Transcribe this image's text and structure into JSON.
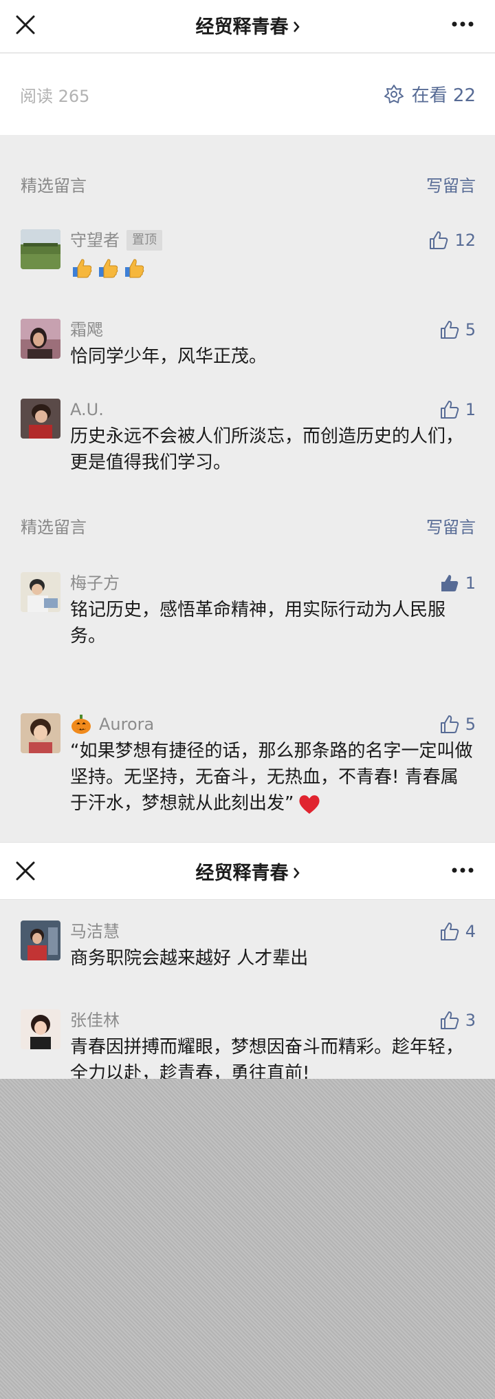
{
  "navbar": {
    "title": "经贸释青春"
  },
  "readbar": {
    "reads": "阅读 265",
    "watching": "在看 22"
  },
  "sections": [
    {
      "label": "精选留言",
      "write": "写留言"
    },
    {
      "label": "精选留言",
      "write": "写留言"
    }
  ],
  "comments": [
    {
      "nick": "守望者",
      "pinned": "置顶",
      "likes": "12",
      "text": ""
    },
    {
      "nick": "霜飔",
      "likes": "5",
      "text": "恰同学少年，风华正茂。"
    },
    {
      "nick": "A.U.",
      "likes": "1",
      "text": "历史永远不会被人们所淡忘，而创造历史的人们，更是值得我们学习。"
    },
    {
      "nick": "梅子方",
      "likes": "1",
      "text": "铭记历史，感悟革命精神，用实际行动为人民服务。"
    },
    {
      "nick": "Aurora",
      "likes": "5",
      "text": "“如果梦想有捷径的话，那么那条路的名字一定叫做坚持。无坚持，无奋斗，无热血，不青春! 青春属于汗水，梦想就从此刻出发”"
    },
    {
      "nick": "马洁慧",
      "likes": "4",
      "text": "商务职院会越来越好 人才辈出"
    },
    {
      "nick": "张佳林",
      "likes": "3",
      "text": "青春因拼搏而耀眼，梦想因奋斗而精彩。趁年轻，全力以赴，趁青春，勇往直前!"
    }
  ],
  "icons": {
    "close": "close-icon",
    "more": "more-icon",
    "chevron": "chevron-right-icon",
    "like": "thumbs-up-icon",
    "watch": "wow-icon"
  },
  "colors": {
    "link": "#576b95",
    "background": "#ededed"
  }
}
